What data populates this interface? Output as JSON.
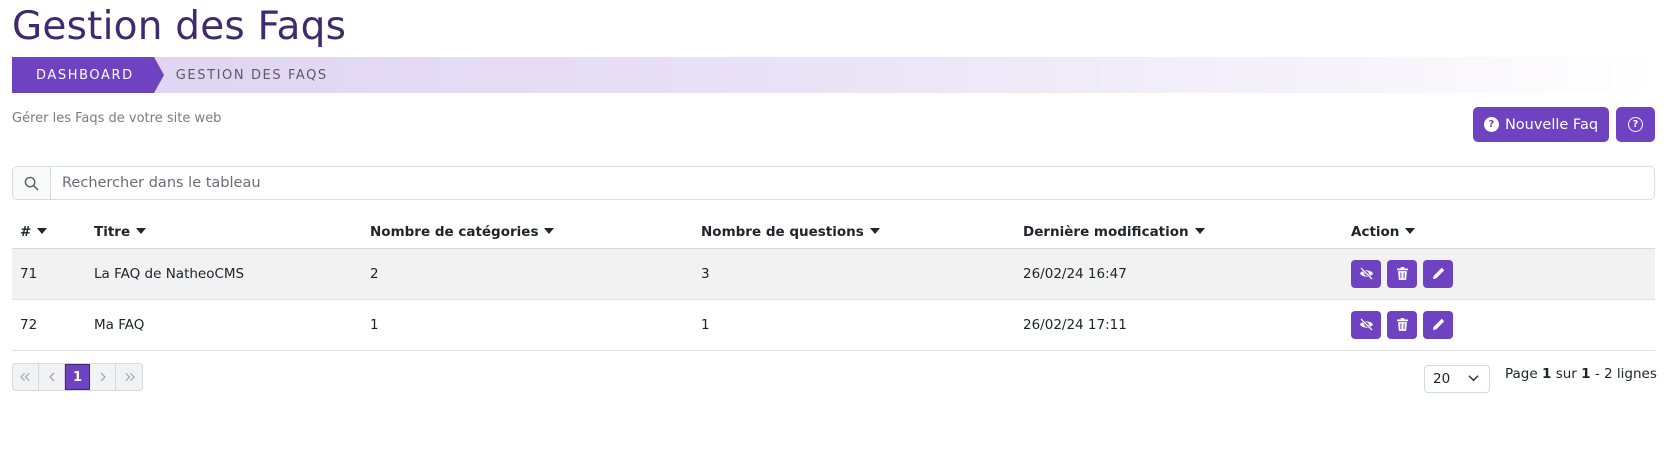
{
  "page": {
    "title": "Gestion des Faqs",
    "subtitle": "Gérer les Faqs de votre site web"
  },
  "breadcrumb": {
    "items": [
      "DASHBOARD",
      "GESTION DES FAQS"
    ]
  },
  "toolbar": {
    "new_label": "Nouvelle Faq",
    "help_icon": "question-circle-icon"
  },
  "search": {
    "placeholder": "Rechercher dans le tableau",
    "value": ""
  },
  "table": {
    "columns": [
      "#",
      "Titre",
      "Nombre de catégories",
      "Nombre de questions",
      "Dernière modification",
      "Action"
    ],
    "rows": [
      {
        "id": "71",
        "title": "La FAQ de NatheoCMS",
        "categories": "2",
        "questions": "3",
        "modified": "26/02/24 16:47"
      },
      {
        "id": "72",
        "title": "Ma FAQ",
        "categories": "1",
        "questions": "1",
        "modified": "26/02/24 17:11"
      }
    ],
    "row_actions": [
      "eye-slash-icon",
      "trash-icon",
      "pencil-icon"
    ]
  },
  "pagination": {
    "current_page": "1",
    "per_page": "20",
    "info_prefix": "Page",
    "info_page": "1",
    "info_of": "sur",
    "info_total_pages": "1",
    "info_sep": "-",
    "info_rows": "2 lignes"
  },
  "colors": {
    "accent": "#6f42c1",
    "title": "#3f2a6e",
    "row_stripe": "#f2f2f2"
  }
}
